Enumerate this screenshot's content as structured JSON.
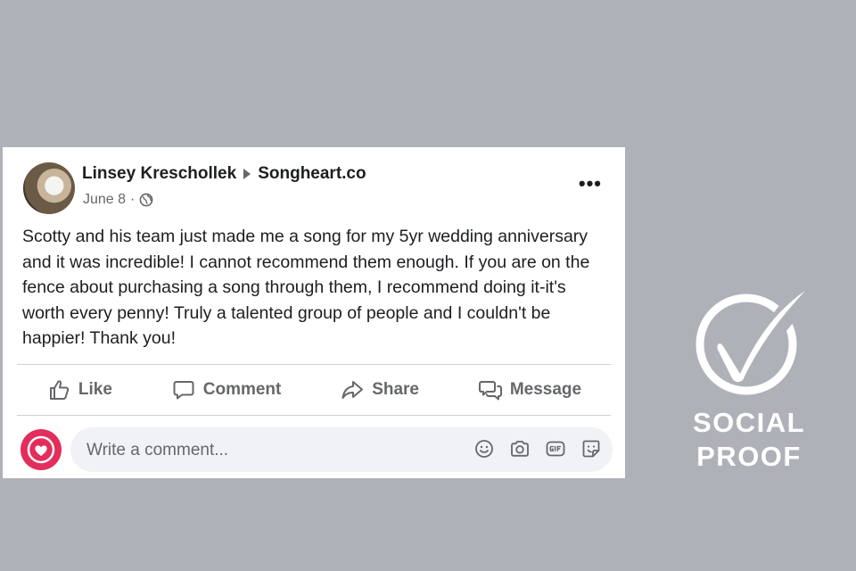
{
  "post": {
    "author": "Linsey Kreschollek",
    "page": "Songheart.co",
    "date": "June 8",
    "separator": "·",
    "more_label": "•••",
    "text": "Scotty and his team just made me a song for my 5yr wedding anniversary and it was incredible! I cannot recommend them enough. If you are on the fence about purchasing a song through them, I recommend doing it-it's worth every penny! Truly a talented group of people and I couldn't be happier! Thank you!"
  },
  "actions": {
    "like": "Like",
    "comment": "Comment",
    "share": "Share",
    "message": "Message"
  },
  "comment_box": {
    "placeholder": "Write a comment..."
  },
  "icons": {
    "privacy": "globe-icon",
    "like": "thumbs-up-icon",
    "comment": "speech-bubble-icon",
    "share": "share-arrow-icon",
    "message": "messenger-icon",
    "emoji": "smiley-icon",
    "camera": "camera-icon",
    "gif": "gif-icon",
    "sticker": "sticker-icon"
  },
  "badge": {
    "line1": "SOCIAL",
    "line2": "PROOF"
  },
  "colors": {
    "background": "#aeb1b8",
    "card": "#ffffff",
    "text": "#1c1e21",
    "muted": "#65676b",
    "brand": "#e32d5c"
  }
}
